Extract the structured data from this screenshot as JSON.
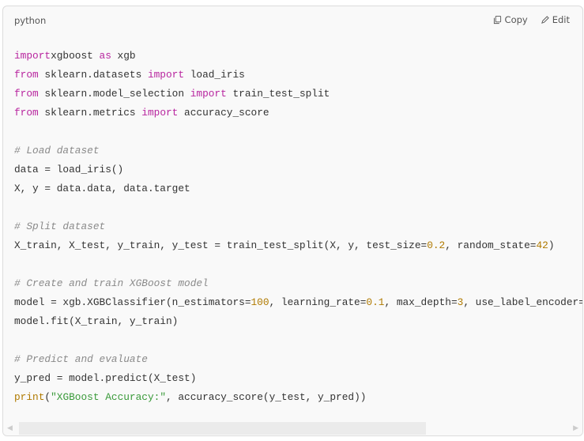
{
  "header": {
    "language": "python",
    "copy_label": "Copy",
    "edit_label": "Edit"
  },
  "icons": {
    "copy": "copy-icon",
    "edit": "pencil-icon"
  },
  "code_lines": [
    [
      [
        "kw",
        "import"
      ],
      [
        "",
        "xgboost "
      ],
      [
        "kw",
        "as"
      ],
      [
        "",
        " xgb"
      ]
    ],
    [
      [
        "kw",
        "from"
      ],
      [
        "",
        " sklearn.datasets "
      ],
      [
        "kw",
        "import"
      ],
      [
        "",
        " load_iris"
      ]
    ],
    [
      [
        "kw",
        "from"
      ],
      [
        "",
        " sklearn.model_selection "
      ],
      [
        "kw",
        "import"
      ],
      [
        "",
        " train_test_split"
      ]
    ],
    [
      [
        "kw",
        "from"
      ],
      [
        "",
        " sklearn.metrics "
      ],
      [
        "kw",
        "import"
      ],
      [
        "",
        " accuracy_score"
      ]
    ],
    [],
    [
      [
        "com",
        "# Load dataset"
      ]
    ],
    [
      [
        "",
        "data = load_iris()"
      ]
    ],
    [
      [
        "",
        "X, y = data.data, data.target"
      ]
    ],
    [],
    [
      [
        "com",
        "# Split dataset"
      ]
    ],
    [
      [
        "",
        "X_train, X_test, y_train, y_test = train_test_split(X, y, test_size="
      ],
      [
        "num",
        "0.2"
      ],
      [
        "",
        ", random_state="
      ],
      [
        "num",
        "42"
      ],
      [
        "",
        ")"
      ]
    ],
    [],
    [
      [
        "com",
        "# Create and train XGBoost model"
      ]
    ],
    [
      [
        "",
        "model = xgb.XGBClassifier(n_estimators="
      ],
      [
        "num",
        "100"
      ],
      [
        "",
        ", learning_rate="
      ],
      [
        "num",
        "0.1"
      ],
      [
        "",
        ", max_depth="
      ],
      [
        "num",
        "3"
      ],
      [
        "",
        ", use_label_encoder="
      ]
    ],
    [
      [
        "",
        "model.fit(X_train, y_train)"
      ]
    ],
    [],
    [
      [
        "com",
        "# Predict and evaluate"
      ]
    ],
    [
      [
        "",
        "y_pred = model.predict(X_test)"
      ]
    ],
    [
      [
        "fn",
        "print"
      ],
      [
        "",
        "("
      ],
      [
        "str",
        "\"XGBoost Accuracy:\""
      ],
      [
        "",
        ", accuracy_score(y_test, y_pred))"
      ]
    ]
  ],
  "colors": {
    "keyword": "#b8259f",
    "number": "#b07a00",
    "string": "#3a9a3a",
    "comment": "#8a8a8a"
  }
}
